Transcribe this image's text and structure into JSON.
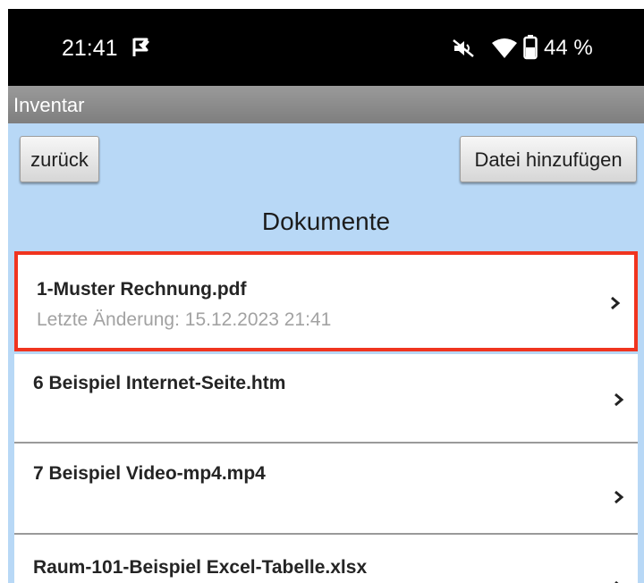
{
  "status_bar": {
    "time": "21:41",
    "battery": "44 %",
    "icons": [
      "notification-flag-icon",
      "mute-icon",
      "wifi-icon",
      "battery-icon"
    ]
  },
  "app": {
    "title": "Inventar"
  },
  "toolbar": {
    "back_label": "zurück",
    "add_file_label": "Datei hinzufügen"
  },
  "section": {
    "title": "Dokumente"
  },
  "documents": [
    {
      "name": "1-Muster Rechnung.pdf",
      "subtitle": "Letzte Änderung: 15.12.2023 21:41",
      "selected": true
    },
    {
      "name": "6 Beispiel Internet-Seite.htm",
      "subtitle": ""
    },
    {
      "name": "7 Beispiel Video-mp4.mp4",
      "subtitle": ""
    },
    {
      "name": "Raum-101-Beispiel Excel-Tabelle.xlsx",
      "subtitle": ""
    }
  ],
  "colors": {
    "background": "#b8d8f6",
    "highlight": "#f0341f",
    "titlebar": "#8a8a8a"
  }
}
